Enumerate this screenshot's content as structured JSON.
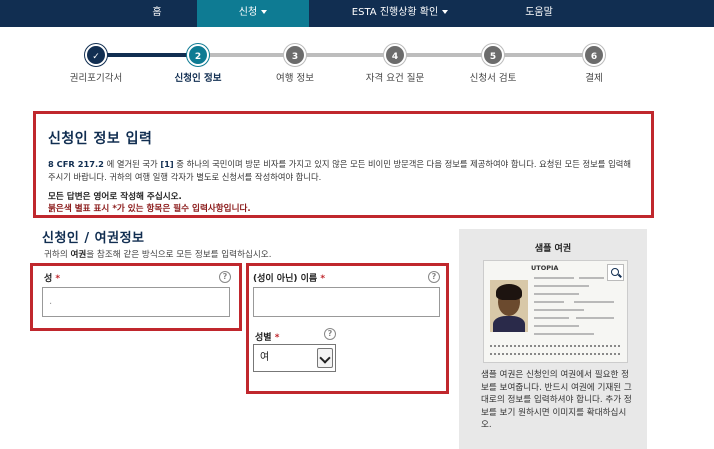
{
  "nav": {
    "home": "홈",
    "apply": "신청",
    "esta_status": "ESTA 진행상황 확인",
    "help": "도움말"
  },
  "steps": [
    {
      "num": "✓",
      "label": "권리포기각서",
      "state": "done"
    },
    {
      "num": "2",
      "label": "신청인 정보",
      "state": "current"
    },
    {
      "num": "3",
      "label": "여행 정보",
      "state": "todo"
    },
    {
      "num": "4",
      "label": "자격 요건 질문",
      "state": "todo"
    },
    {
      "num": "5",
      "label": "신청서 검토",
      "state": "todo"
    },
    {
      "num": "6",
      "label": "결제",
      "state": "todo"
    }
  ],
  "intro": {
    "title": "신청인 정보 입력",
    "cfr": "8 CFR 217.2",
    "body_part1": " 에 열거된 국가 ",
    "fnref": "[1]",
    "body_part2": " 중 하나의 국민이며 방문 비자를 가지고 있지 않은 모든 비이민 방문객은 다음 정보를 제공하여야 합니다. 요청된 모든 정보를 입력해 주시기 바랍니다. 귀하의 여행 일행 각자가 별도로 신청서를 작성하여야 합니다.",
    "note": "모든 답변은 영어로 작성해 주십시오.",
    "required_note": "붉은색 별표 표시 *가 있는 항목은 필수 입력사항입니다."
  },
  "section": {
    "title": "신청인 / 여권정보",
    "desc_prefix": "귀하의 ",
    "desc_bold": "여권",
    "desc_suffix": "을 참조해 같은 방식으로 모든 정보를 입력하십시오."
  },
  "fields": {
    "surname_label": "성",
    "surname_value": ".",
    "given_name_label": "(성이 아닌) 이름",
    "given_name_value": "",
    "gender_label": "성별",
    "gender_value": "여",
    "required_mark": " *",
    "help": "?"
  },
  "sample": {
    "title": "샘플 여권",
    "passport_country": "UTOPIA",
    "description": "샘플 여권은 신청인의 여권에서 필요한 정보를 보여줍니다. 반드시 여권에 기재된 그대로의 정보를 입력하셔야 합니다. 추가 정보를 보기 원하시면 이미지를 확대하십시오."
  },
  "colors": {
    "nav_bg": "#112e51",
    "nav_active": "#0e7b93",
    "highlight_border": "#c0272d"
  }
}
